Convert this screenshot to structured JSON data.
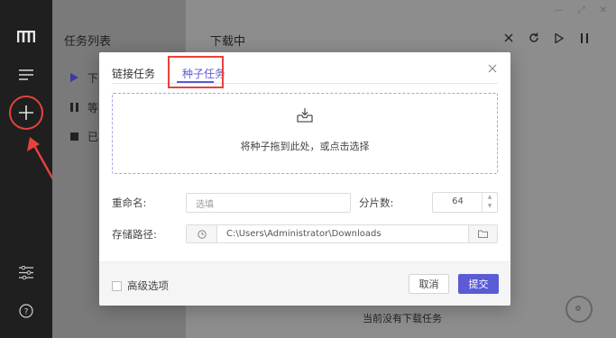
{
  "app": {
    "tasklist_title": "任务列表",
    "task_items": [
      {
        "label": "下",
        "icon": "play-icon"
      },
      {
        "label": "等",
        "icon": "pause-icon"
      },
      {
        "label": "已",
        "icon": "stop-icon"
      }
    ],
    "main_title": "下载中",
    "empty_text": "当前没有下载任务",
    "accent_color": "#5b5bd6",
    "annotation_color": "#e5433d"
  },
  "dialog": {
    "tabs": [
      "链接任务",
      "种子任务"
    ],
    "active_tab": "种子任务",
    "dropzone_text": "将种子拖到此处，或点击选择",
    "rename_label": "重命名:",
    "rename_placeholder": "选填",
    "split_label": "分片数:",
    "split_value": "64",
    "path_label": "存储路径:",
    "path_value": "C:\\Users\\Administrator\\Downloads",
    "advanced_label": "高级选项",
    "cancel_label": "取消",
    "submit_label": "提交"
  }
}
